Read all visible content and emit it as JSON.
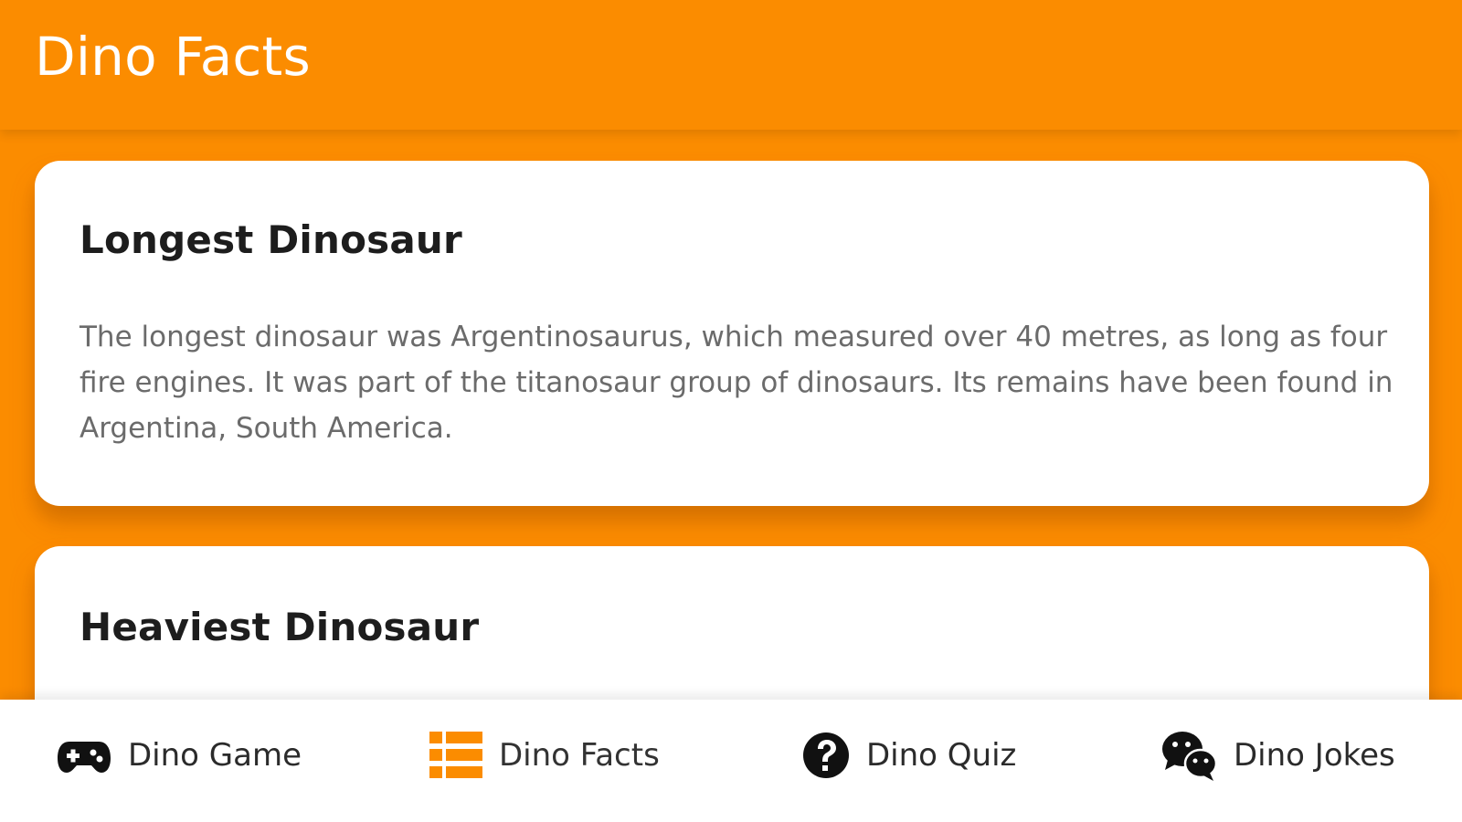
{
  "app_bar": {
    "title": "Dino Facts",
    "background": "#fb8c00"
  },
  "facts": [
    {
      "title": "Longest Dinosaur",
      "text": "The longest dinosaur was Argentinosaurus, which measured over 40 metres, as long as four fire engines. It was part of the titanosaur group of dinosaurs. Its remains have been found in Argentina, South America."
    },
    {
      "title": "Heaviest Dinosaur"
    }
  ],
  "bottom_nav": {
    "items": [
      {
        "label": "Dino Game",
        "icon": "gamepad-icon"
      },
      {
        "label": "Dino Facts",
        "icon": "list-icon",
        "active": true,
        "active_color": "#fb8c00"
      },
      {
        "label": "Dino Quiz",
        "icon": "question-circle-icon"
      },
      {
        "label": "Dino Jokes",
        "icon": "chat-bubbles-icon"
      }
    ]
  }
}
